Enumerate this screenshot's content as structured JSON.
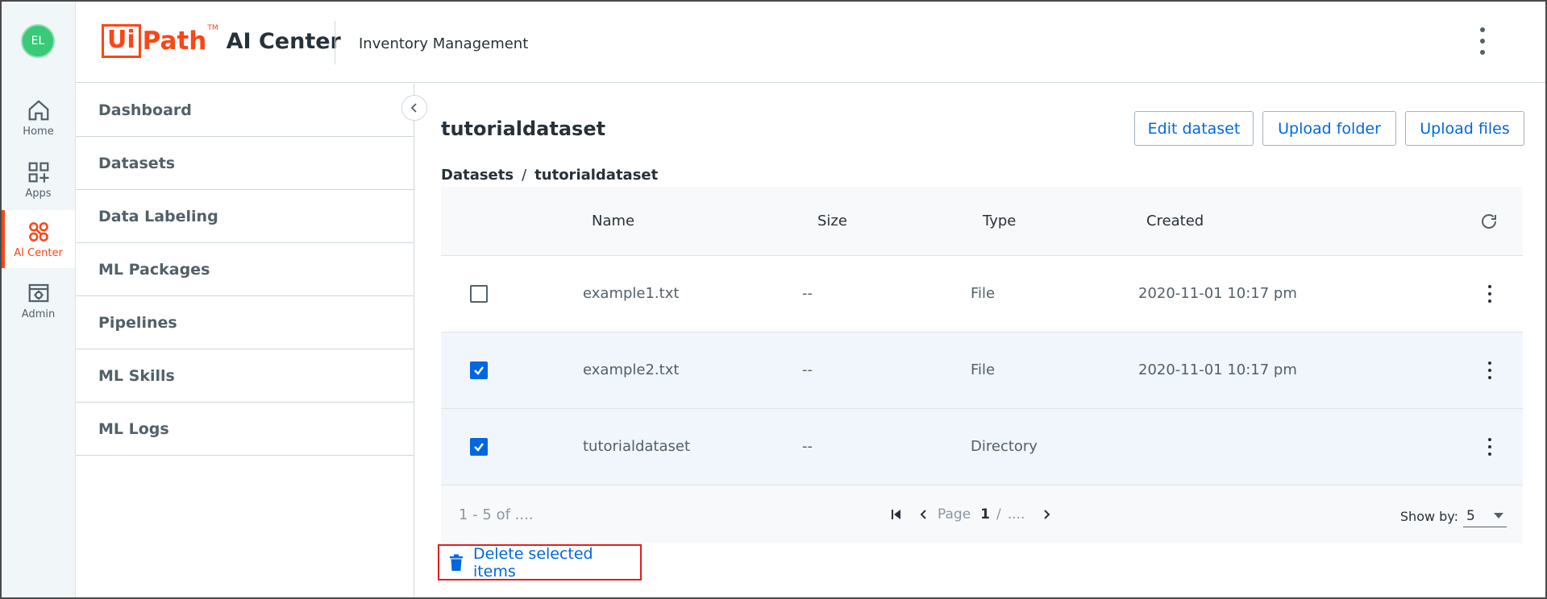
{
  "rail": {
    "avatar": "EL",
    "items": [
      {
        "label": "Home",
        "icon": "home-icon"
      },
      {
        "label": "Apps",
        "icon": "apps-icon"
      },
      {
        "label": "AI Center",
        "icon": "ai-center-icon",
        "active": true
      },
      {
        "label": "Admin",
        "icon": "admin-icon"
      }
    ]
  },
  "header": {
    "logo_ui": "Ui",
    "logo_path": "Path",
    "logo_tm": "TM",
    "logo_product": "AI Center",
    "tenant": "Inventory Management"
  },
  "subnav": {
    "items": [
      "Dashboard",
      "Datasets",
      "Data Labeling",
      "ML Packages",
      "Pipelines",
      "ML Skills",
      "ML Logs"
    ]
  },
  "page": {
    "title": "tutorialdataset",
    "actions": {
      "edit": "Edit dataset",
      "upload_folder": "Upload folder",
      "upload_files": "Upload files"
    },
    "breadcrumb": {
      "root": "Datasets",
      "separator": "/",
      "current": "tutorialdataset"
    }
  },
  "table": {
    "columns": {
      "name": "Name",
      "size": "Size",
      "type": "Type",
      "created": "Created"
    },
    "rows": [
      {
        "name": "example1.txt",
        "size": "--",
        "type": "File",
        "created": "2020-11-01 10:17 pm",
        "checked": false
      },
      {
        "name": "example2.txt",
        "size": "--",
        "type": "File",
        "created": "2020-11-01 10:17 pm",
        "checked": true
      },
      {
        "name": "tutorialdataset",
        "size": "--",
        "type": "Directory",
        "created": "",
        "checked": true
      }
    ]
  },
  "pager": {
    "range": "1 - 5 of ....",
    "page_label": "Page",
    "page": "1",
    "separator": "/",
    "total": "....",
    "show_by_label": "Show by:",
    "show_by_value": "5"
  },
  "bulk_action": {
    "delete_label": "Delete selected items"
  },
  "colors": {
    "accent": "#fa4616",
    "link": "#0067df",
    "highlight_border": "#e0201e",
    "avatar": "#38c979"
  }
}
